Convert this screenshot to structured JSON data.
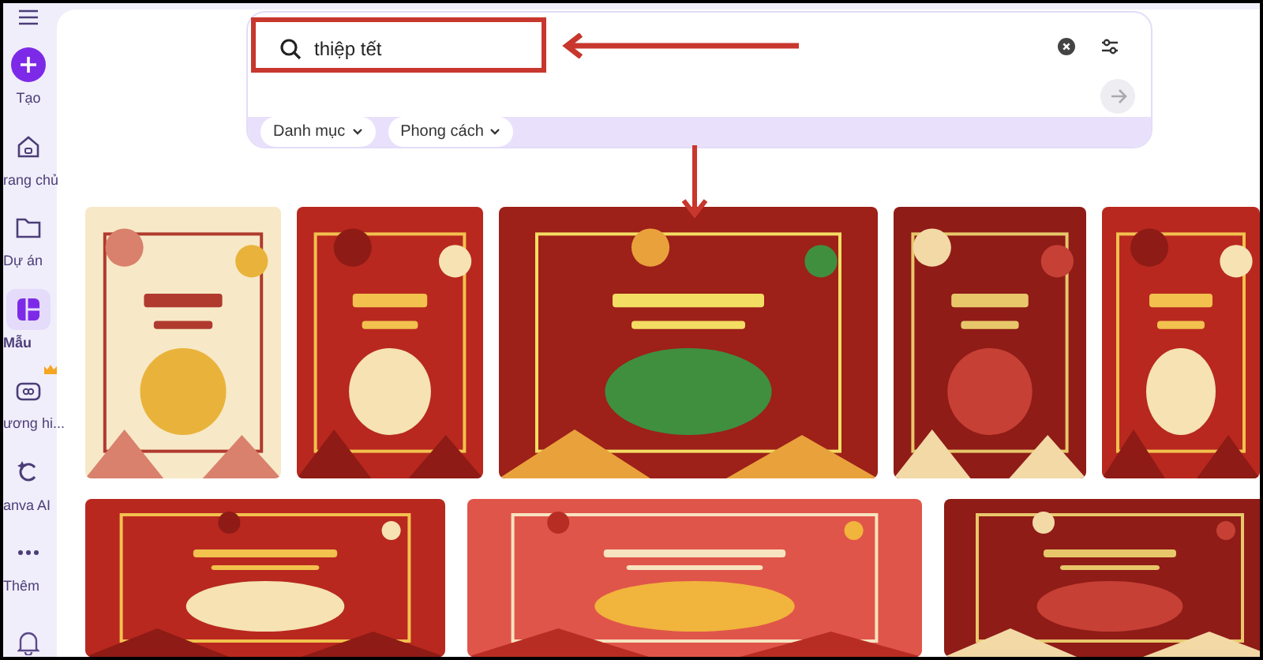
{
  "sidebar": {
    "items": [
      {
        "kind": "create",
        "label": "Tạo",
        "selected": false
      },
      {
        "kind": "home",
        "label": "rang chủ",
        "selected": false
      },
      {
        "kind": "folder",
        "label": "Dự án",
        "selected": false
      },
      {
        "kind": "templates",
        "label": "Mẫu",
        "selected": true
      },
      {
        "kind": "brand",
        "label": "ương hi...",
        "selected": false,
        "premium": true
      },
      {
        "kind": "ai",
        "label": "anva AI",
        "selected": false
      },
      {
        "kind": "more",
        "label": "Thêm",
        "selected": false
      }
    ]
  },
  "search": {
    "value": "thiệp tết",
    "filters": [
      "Danh mục",
      "Phong cách"
    ]
  }
}
